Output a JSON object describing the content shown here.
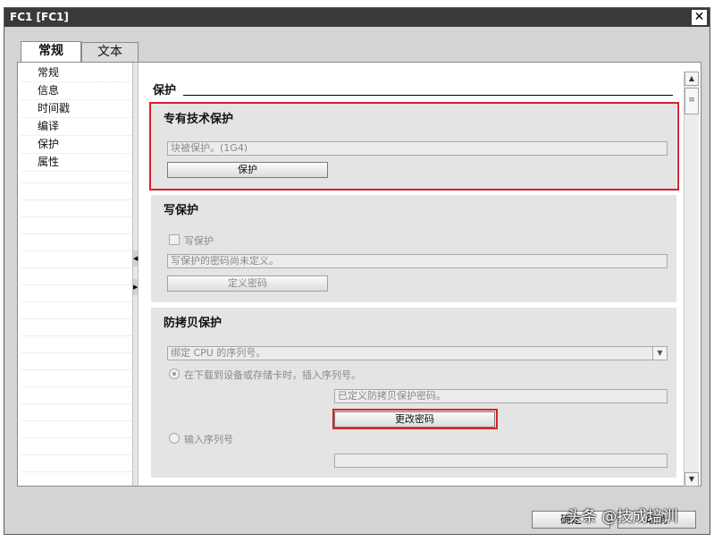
{
  "window": {
    "title": "FC1 [FC1]",
    "close_glyph": "✕"
  },
  "tabs": [
    {
      "label": "常规"
    },
    {
      "label": "文本"
    }
  ],
  "nav": {
    "items": [
      {
        "label": "常规"
      },
      {
        "label": "信息"
      },
      {
        "label": "时间戳"
      },
      {
        "label": "编译"
      },
      {
        "label": "保护"
      },
      {
        "label": "属性"
      }
    ]
  },
  "section": {
    "title": "保护"
  },
  "know_how": {
    "title": "专有技术保护",
    "status_text": "块被保护。(1G4)",
    "button_label": "保护"
  },
  "write_protection": {
    "title": "写保护",
    "checkbox_label": "写保护",
    "status_text": "写保护的密码尚未定义。",
    "button_label": "定义密码"
  },
  "copy_protection": {
    "title": "防拷贝保护",
    "dropdown_value": "绑定 CPU 的序列号。",
    "radio1_label": "在下载到设备或存储卡时，插入序列号。",
    "status_text": "已定义防拷贝保护密码。",
    "button_label": "更改密码",
    "radio2_label": "输入序列号",
    "serial_value": ""
  },
  "footer": {
    "ok_label": "确定",
    "cancel_label": "取消"
  },
  "watermark": {
    "text": "头条 @技成培训"
  },
  "colors": {
    "highlight": "#d9222b",
    "titlebar": "#3a3a3a"
  }
}
